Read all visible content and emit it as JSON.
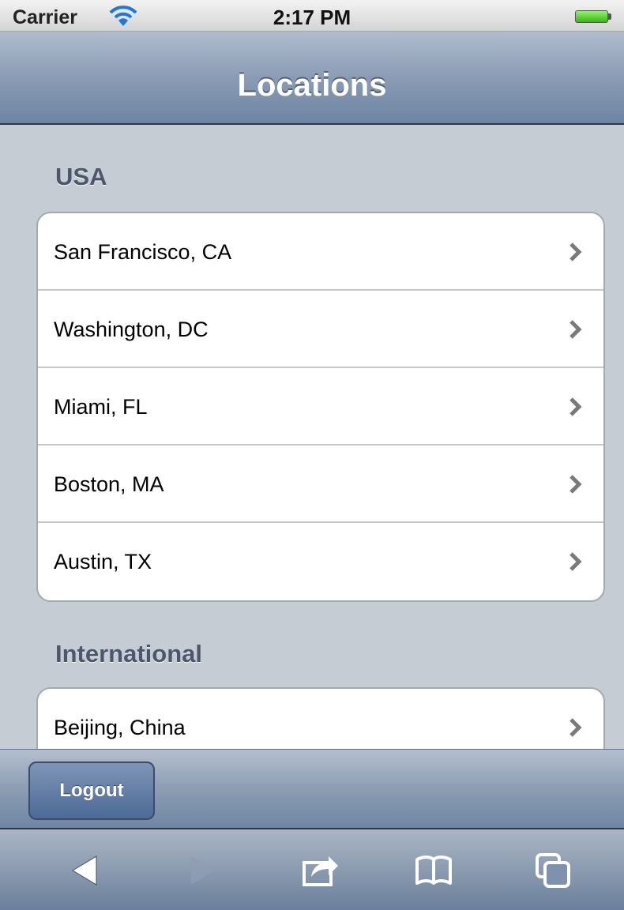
{
  "status_bar": {
    "carrier": "Carrier",
    "time": "2:17 PM"
  },
  "nav": {
    "title": "Locations"
  },
  "sections": [
    {
      "header": "USA",
      "items": [
        "San Francisco, CA",
        "Washington, DC",
        "Miami, FL",
        "Boston, MA",
        "Austin, TX"
      ]
    },
    {
      "header": "International",
      "items": [
        "Beijing, China"
      ]
    }
  ],
  "toolbar": {
    "logout_label": "Logout"
  },
  "browser_bar": {
    "icons": [
      "back-icon",
      "forward-icon",
      "share-icon",
      "bookmarks-icon",
      "tabs-icon"
    ]
  },
  "colors": {
    "nav_gradient_top": "#b0bccd",
    "nav_gradient_bottom": "#6d84a2",
    "background": "#c5ccd4",
    "section_header": "#4c566c"
  }
}
